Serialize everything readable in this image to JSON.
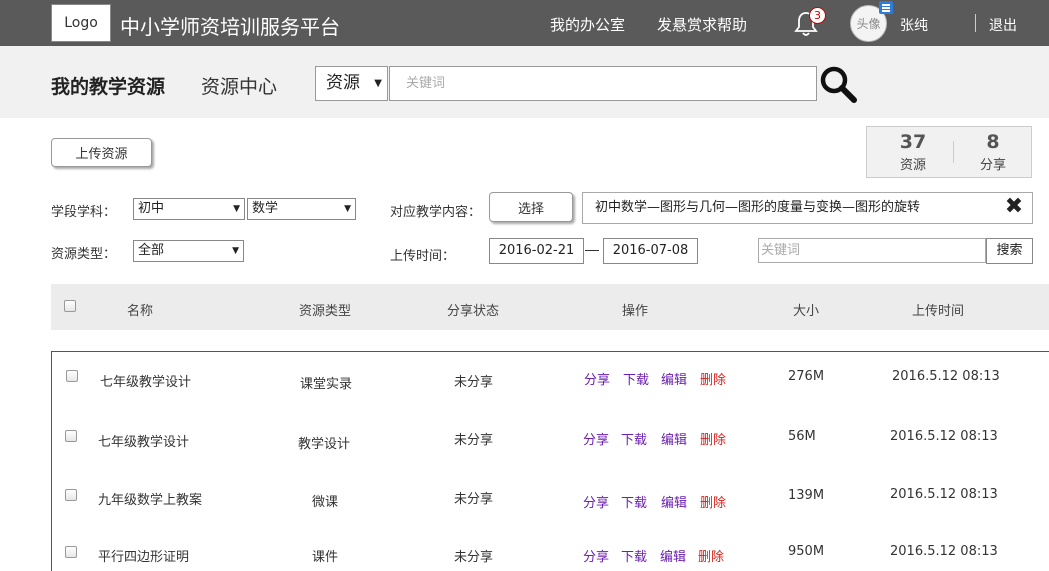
{
  "header": {
    "logo": "Logo",
    "site_title": "中小学师资培训服务平台",
    "nav": [
      "我的办公室",
      "发悬赏求帮助"
    ],
    "notification_count": "3",
    "avatar_text": "头像",
    "username": "张纯",
    "logout": "退出"
  },
  "subheader": {
    "title": "我的教学资源",
    "subtitle": "资源中心",
    "search_type": "资源",
    "search_placeholder": "关键词"
  },
  "toolbar": {
    "upload_label": "上传资源",
    "stats": [
      {
        "value": "37",
        "label": "资源"
      },
      {
        "value": "8",
        "label": "分享"
      }
    ]
  },
  "filters": {
    "grade_subject_label": "学段学科：",
    "stage_value": "初中",
    "subject_value": "数学",
    "content_label": "对应教学内容：",
    "select_button": "选择",
    "content_value": "初中数学—图形与几何—图形的度量与变换—图形的旋转",
    "type_label": "资源类型：",
    "type_value": "全部",
    "time_label": "上传时间：",
    "date_from": "2016-02-21",
    "date_to": "2016-07-08",
    "keyword_placeholder": "关键词",
    "search_button": "搜索"
  },
  "table": {
    "columns": [
      "名称",
      "资源类型",
      "分享状态",
      "操作",
      "大小",
      "上传时间"
    ],
    "actions": [
      "分享",
      "下载",
      "编辑",
      "删除"
    ],
    "rows": [
      {
        "name": "七年级教学设计",
        "type": "课堂实录",
        "status": "未分享",
        "size": "276M",
        "time": "2016.5.12 08:13"
      },
      {
        "name": "七年级教学设计",
        "type": "教学设计",
        "status": "未分享",
        "size": "56M",
        "time": "2016.5.12 08:13"
      },
      {
        "name": "九年级数学上教案",
        "type": "微课",
        "status": "未分享",
        "size": "139M",
        "time": "2016.5.12 08:13"
      },
      {
        "name": "平行四边形证明",
        "type": "课件",
        "status": "未分享",
        "size": "950M",
        "time": "2016.5.12 08:13"
      }
    ]
  }
}
